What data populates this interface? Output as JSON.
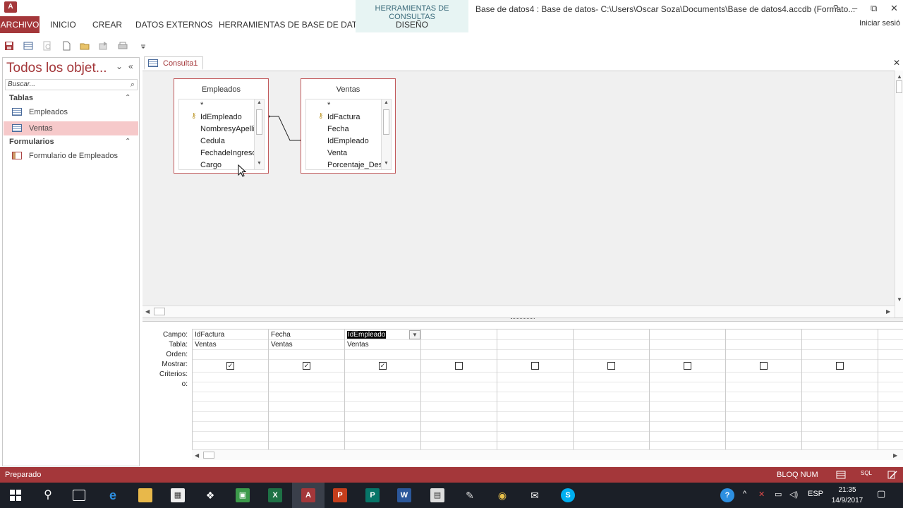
{
  "app": {
    "icon_label": "A",
    "document_title": "Base de datos4 : Base de datos- C:\\Users\\Oscar Soza\\Documents\\Base de datos4.accdb (Formato...",
    "login": "Iniciar sesió"
  },
  "ribbon": {
    "tabs": [
      "ARCHIVO",
      "INICIO",
      "CREAR",
      "DATOS EXTERNOS",
      "HERRAMIENTAS DE BASE DE DATOS"
    ],
    "context_group": "HERRAMIENTAS DE CONSULTAS",
    "context_tab": "DISEÑO"
  },
  "window_controls": {
    "help": "?",
    "minimize": "–",
    "restore": "⧉",
    "close": "✕"
  },
  "nav": {
    "title": "Todos los objet...",
    "search_placeholder": "Buscar...",
    "groups": [
      {
        "label": "Tablas",
        "items": [
          "Empleados",
          "Ventas"
        ]
      },
      {
        "label": "Formularios",
        "items": [
          "Formulario de Empleados"
        ]
      }
    ],
    "selected": "Ventas"
  },
  "document": {
    "tab_label": "Consulta1"
  },
  "field_lists": [
    {
      "title": "Empleados",
      "fields": [
        "*",
        "IdEmpleado",
        "NombresyApellidos",
        "Cedula",
        "FechadeIngreso",
        "Cargo"
      ],
      "key": "IdEmpleado"
    },
    {
      "title": "Ventas",
      "fields": [
        "*",
        "IdFactura",
        "Fecha",
        "IdEmpleado",
        "Venta",
        "Porcentaje_Descuento"
      ],
      "key": "IdFactura"
    }
  ],
  "grid": {
    "row_labels": [
      "Campo:",
      "Tabla:",
      "Orden:",
      "Mostrar:",
      "Criterios:",
      "o:"
    ],
    "columns": [
      {
        "campo": "IdFactura",
        "tabla": "Ventas",
        "mostrar": true
      },
      {
        "campo": "Fecha",
        "tabla": "Ventas",
        "mostrar": true
      },
      {
        "campo": "IdEmpleado",
        "tabla": "Ventas",
        "mostrar": true,
        "selected": true
      },
      {
        "campo": "",
        "tabla": "",
        "mostrar": false
      },
      {
        "campo": "",
        "tabla": "",
        "mostrar": false
      },
      {
        "campo": "",
        "tabla": "",
        "mostrar": false
      },
      {
        "campo": "",
        "tabla": "",
        "mostrar": false
      },
      {
        "campo": "",
        "tabla": "",
        "mostrar": false
      },
      {
        "campo": "",
        "tabla": "",
        "mostrar": false
      }
    ]
  },
  "status": {
    "left": "Preparado",
    "right": "BLOQ NUM",
    "sql": "SQL"
  },
  "taskbar": {
    "language": "ESP",
    "time": "21:35",
    "date": "14/9/2017"
  },
  "colors": {
    "accent": "#a4373a",
    "context_tab_bg": "#e7f4f3",
    "taskbar": "#1b1f27"
  }
}
